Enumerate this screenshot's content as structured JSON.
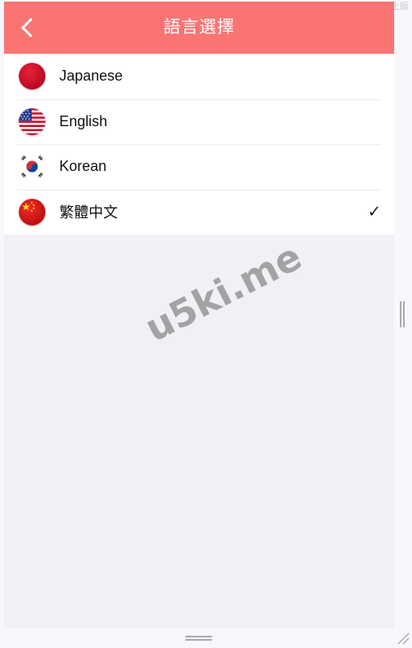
{
  "header": {
    "title": "語言選擇",
    "back_icon": "chevron-left-icon",
    "background": "#fa7474"
  },
  "languages": [
    {
      "label": "Japanese",
      "flag": "japan-flag-icon",
      "selected": false
    },
    {
      "label": "English",
      "flag": "usa-flag-icon",
      "selected": false
    },
    {
      "label": "Korean",
      "flag": "korea-flag-icon",
      "selected": false
    },
    {
      "label": "繁體中文",
      "flag": "china-flag-icon",
      "selected": true
    }
  ],
  "selected_mark": "✓",
  "watermark": "u5ki.me",
  "corner_text": "上版"
}
